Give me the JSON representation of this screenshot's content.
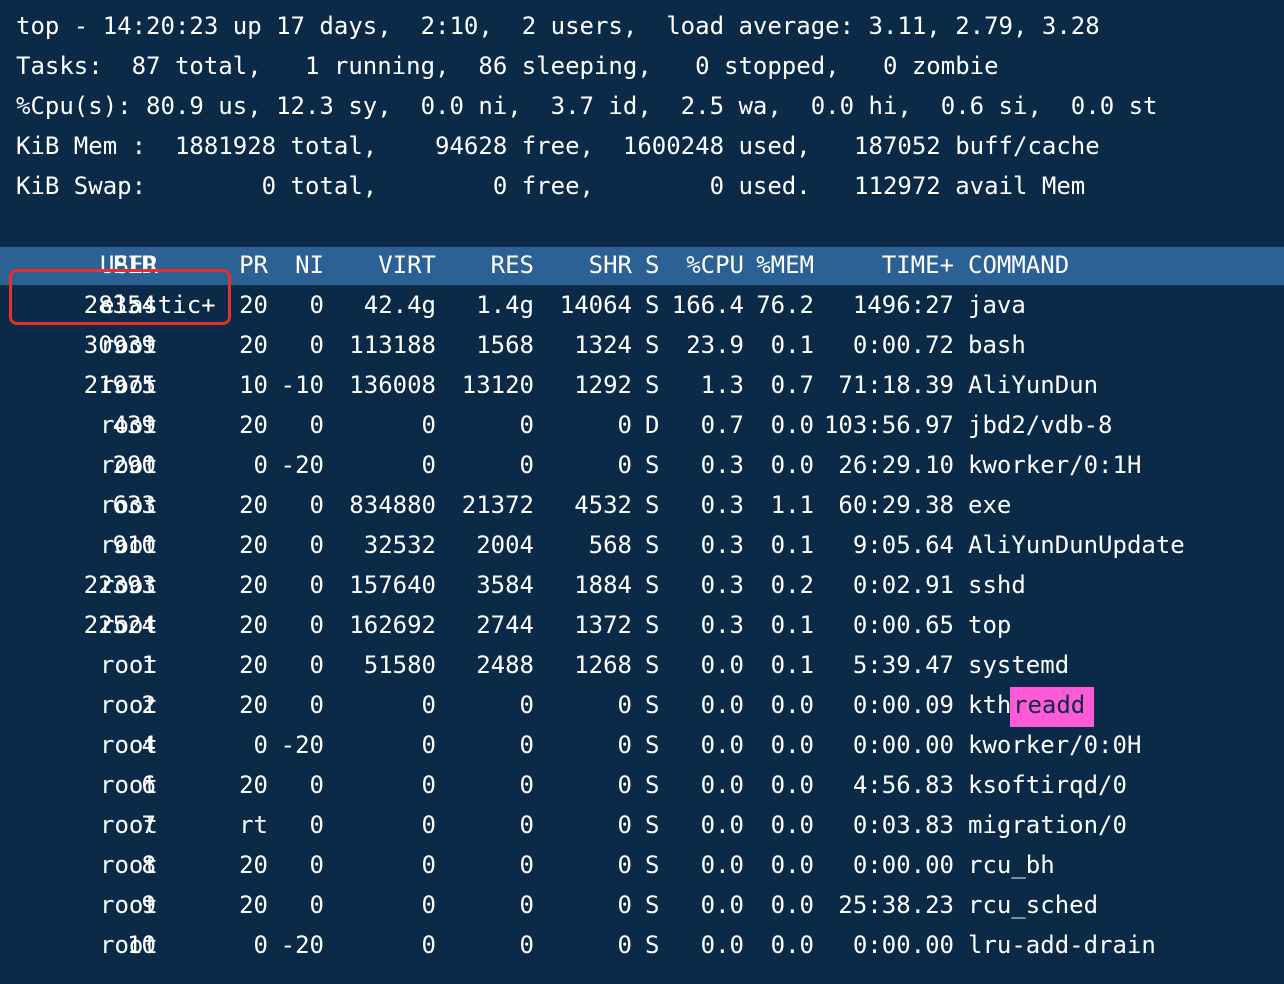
{
  "summary": {
    "line1": "top - 14:20:23 up 17 days,  2:10,  2 users,  load average: 3.11, 2.79, 3.28",
    "line2": "Tasks:  87 total,   1 running,  86 sleeping,   0 stopped,   0 zombie",
    "line3": "%Cpu(s): 80.9 us, 12.3 sy,  0.0 ni,  3.7 id,  2.5 wa,  0.0 hi,  0.6 si,  0.0 st",
    "line4": "KiB Mem :  1881928 total,    94628 free,  1600248 used,   187052 buff/cache",
    "line5": "KiB Swap:        0 total,        0 free,        0 used.   112972 avail Mem"
  },
  "colors": {
    "background": "#0b2a47",
    "header_bar": "#2b6195",
    "text": "#ffffff",
    "highlight_box": "#e2322b",
    "pink_highlight": "#ff5bd6"
  },
  "header": {
    "pid": "PID",
    "user": "USER",
    "pr": "PR",
    "ni": "NI",
    "virt": "VIRT",
    "res": "RES",
    "shr": "SHR",
    "s": "S",
    "cpu": "%CPU",
    "mem": "%MEM",
    "time": "TIME+",
    "command": "COMMAND"
  },
  "processes": [
    {
      "pid": "28354",
      "user": "elastic+",
      "pr": "20",
      "ni": "0",
      "virt": "42.4g",
      "res": "1.4g",
      "shr": "14064",
      "s": "S",
      "cpu": "166.4",
      "mem": "76.2",
      "time": "1496:27",
      "command": "java"
    },
    {
      "pid": "30939",
      "user": "root",
      "pr": "20",
      "ni": "0",
      "virt": "113188",
      "res": "1568",
      "shr": "1324",
      "s": "S",
      "cpu": "23.9",
      "mem": "0.1",
      "time": "0:00.72",
      "command": "bash"
    },
    {
      "pid": "21975",
      "user": "root",
      "pr": "10",
      "ni": "-10",
      "virt": "136008",
      "res": "13120",
      "shr": "1292",
      "s": "S",
      "cpu": "1.3",
      "mem": "0.7",
      "time": "71:18.39",
      "command": "AliYunDun"
    },
    {
      "pid": "439",
      "user": "root",
      "pr": "20",
      "ni": "0",
      "virt": "0",
      "res": "0",
      "shr": "0",
      "s": "D",
      "cpu": "0.7",
      "mem": "0.0",
      "time": "103:56.97",
      "command": "jbd2/vdb-8"
    },
    {
      "pid": "290",
      "user": "root",
      "pr": "0",
      "ni": "-20",
      "virt": "0",
      "res": "0",
      "shr": "0",
      "s": "S",
      "cpu": "0.3",
      "mem": "0.0",
      "time": "26:29.10",
      "command": "kworker/0:1H"
    },
    {
      "pid": "633",
      "user": "root",
      "pr": "20",
      "ni": "0",
      "virt": "834880",
      "res": "21372",
      "shr": "4532",
      "s": "S",
      "cpu": "0.3",
      "mem": "1.1",
      "time": "60:29.38",
      "command": "exe"
    },
    {
      "pid": "910",
      "user": "root",
      "pr": "20",
      "ni": "0",
      "virt": "32532",
      "res": "2004",
      "shr": "568",
      "s": "S",
      "cpu": "0.3",
      "mem": "0.1",
      "time": "9:05.64",
      "command": "AliYunDunUpdate"
    },
    {
      "pid": "22393",
      "user": "root",
      "pr": "20",
      "ni": "0",
      "virt": "157640",
      "res": "3584",
      "shr": "1884",
      "s": "S",
      "cpu": "0.3",
      "mem": "0.2",
      "time": "0:02.91",
      "command": "sshd"
    },
    {
      "pid": "22524",
      "user": "root",
      "pr": "20",
      "ni": "0",
      "virt": "162692",
      "res": "2744",
      "shr": "1372",
      "s": "S",
      "cpu": "0.3",
      "mem": "0.1",
      "time": "0:00.65",
      "command": "top"
    },
    {
      "pid": "1",
      "user": "root",
      "pr": "20",
      "ni": "0",
      "virt": "51580",
      "res": "2488",
      "shr": "1268",
      "s": "S",
      "cpu": "0.0",
      "mem": "0.1",
      "time": "5:39.47",
      "command": "systemd"
    },
    {
      "pid": "2",
      "user": "root",
      "pr": "20",
      "ni": "0",
      "virt": "0",
      "res": "0",
      "shr": "0",
      "s": "S",
      "cpu": "0.0",
      "mem": "0.0",
      "time": "0:00.09",
      "command": "kth"
    },
    {
      "pid": "4",
      "user": "root",
      "pr": "0",
      "ni": "-20",
      "virt": "0",
      "res": "0",
      "shr": "0",
      "s": "S",
      "cpu": "0.0",
      "mem": "0.0",
      "time": "0:00.00",
      "command": "kworker/0:0H"
    },
    {
      "pid": "6",
      "user": "root",
      "pr": "20",
      "ni": "0",
      "virt": "0",
      "res": "0",
      "shr": "0",
      "s": "S",
      "cpu": "0.0",
      "mem": "0.0",
      "time": "4:56.83",
      "command": "ksoftirqd/0"
    },
    {
      "pid": "7",
      "user": "root",
      "pr": "rt",
      "ni": "0",
      "virt": "0",
      "res": "0",
      "shr": "0",
      "s": "S",
      "cpu": "0.0",
      "mem": "0.0",
      "time": "0:03.83",
      "command": "migration/0"
    },
    {
      "pid": "8",
      "user": "root",
      "pr": "20",
      "ni": "0",
      "virt": "0",
      "res": "0",
      "shr": "0",
      "s": "S",
      "cpu": "0.0",
      "mem": "0.0",
      "time": "0:00.00",
      "command": "rcu_bh"
    },
    {
      "pid": "9",
      "user": "root",
      "pr": "20",
      "ni": "0",
      "virt": "0",
      "res": "0",
      "shr": "0",
      "s": "S",
      "cpu": "0.0",
      "mem": "0.0",
      "time": "25:38.23",
      "command": "rcu_sched"
    },
    {
      "pid": "10",
      "user": "root",
      "pr": "0",
      "ni": "-20",
      "virt": "0",
      "res": "0",
      "shr": "0",
      "s": "S",
      "cpu": "0.0",
      "mem": "0.0",
      "time": "0:00.00",
      "command": "lru-add-drain"
    }
  ],
  "annotations": {
    "pink_text": "readd"
  }
}
